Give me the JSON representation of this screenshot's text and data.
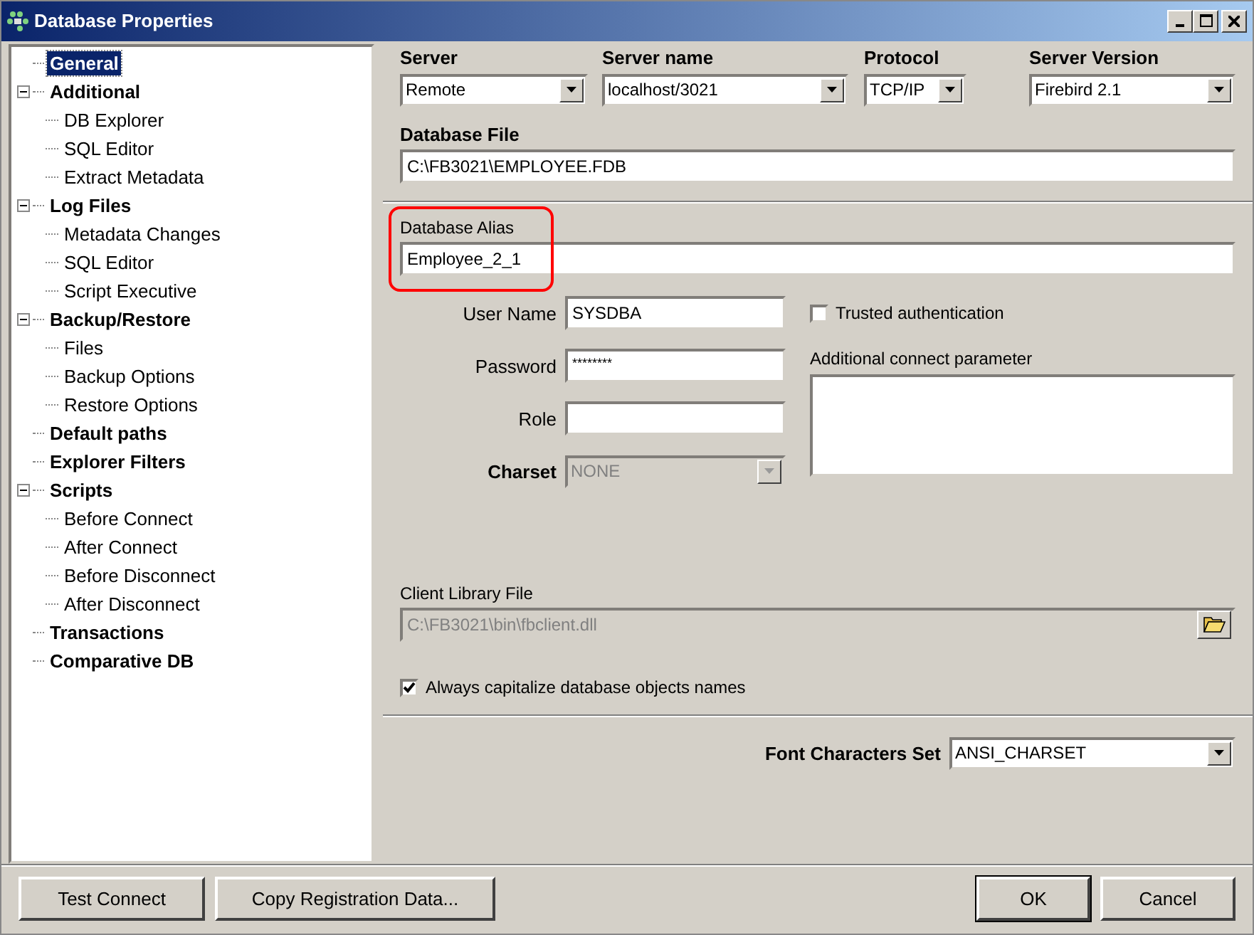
{
  "window": {
    "title": "Database Properties"
  },
  "tree": [
    {
      "label": "General",
      "selected": true
    },
    {
      "label": "Additional",
      "selected": false,
      "expanded": true,
      "children": [
        {
          "label": "DB Explorer",
          "selected": false
        },
        {
          "label": "SQL Editor",
          "selected": false
        },
        {
          "label": "Extract Metadata",
          "selected": false
        }
      ]
    },
    {
      "label": "Log Files",
      "selected": false,
      "expanded": true,
      "children": [
        {
          "label": "Metadata Changes",
          "selected": false
        },
        {
          "label": "SQL Editor",
          "selected": false
        },
        {
          "label": "Script Executive",
          "selected": false
        }
      ]
    },
    {
      "label": "Backup/Restore",
      "selected": false,
      "expanded": true,
      "children": [
        {
          "label": "Files",
          "selected": false
        },
        {
          "label": "Backup Options",
          "selected": false
        },
        {
          "label": "Restore Options",
          "selected": false
        }
      ]
    },
    {
      "label": "Default paths",
      "selected": false
    },
    {
      "label": "Explorer Filters",
      "selected": false
    },
    {
      "label": "Scripts",
      "selected": false,
      "expanded": true,
      "children": [
        {
          "label": "Before Connect",
          "selected": false
        },
        {
          "label": "After Connect",
          "selected": false
        },
        {
          "label": "Before Disconnect",
          "selected": false
        },
        {
          "label": "After Disconnect",
          "selected": false
        }
      ]
    },
    {
      "label": "Transactions",
      "selected": false
    },
    {
      "label": "Comparative DB",
      "selected": false
    }
  ],
  "server_row": [
    {
      "label": "Server",
      "value": "Remote"
    },
    {
      "label": "Server name",
      "value": "localhost/3021"
    },
    {
      "label": "Protocol",
      "value": "TCP/IP"
    },
    {
      "label": "Server Version",
      "value": "Firebird 2.1"
    }
  ],
  "database_file": {
    "label": "Database File",
    "value": "C:\\FB3021\\EMPLOYEE.FDB"
  },
  "database_alias": {
    "label": "Database Alias",
    "value": "Employee_2_1",
    "highlighted": true
  },
  "credentials": [
    {
      "label": "User Name",
      "value": "SYSDBA",
      "kind": "text"
    },
    {
      "label": "Password",
      "value": "********",
      "kind": "text"
    },
    {
      "label": "Role",
      "kind": "text"
    },
    {
      "label": "Charset",
      "value": "NONE",
      "kind": "combo",
      "disabled": true
    }
  ],
  "trusted_authentication": {
    "label": "Trusted authentication",
    "checked": false
  },
  "additional_parameters": {
    "label": "Additional connect parameter"
  },
  "client_library": {
    "label": "Client Library File",
    "value": "C:\\FB3021\\bin\\fbclient.dll",
    "disabled": true
  },
  "capitalize_names": {
    "label": "Always capitalize database objects names",
    "checked": true
  },
  "font_charset": {
    "label": "Font Characters Set",
    "value": "ANSI_CHARSET"
  },
  "buttons_left": [
    {
      "label": "Test Connect",
      "default": false
    },
    {
      "label": "Copy Registration Data...",
      "default": false
    }
  ],
  "buttons_right": [
    {
      "label": "OK",
      "default": true
    },
    {
      "label": "Cancel",
      "default": false
    }
  ]
}
